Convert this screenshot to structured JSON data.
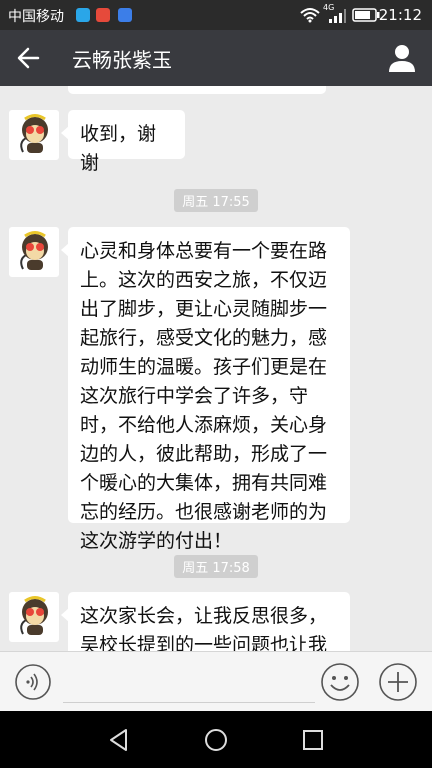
{
  "status_bar": {
    "carrier": "中国移动",
    "network": "4G",
    "time": "21:12"
  },
  "header": {
    "title": "云畅张紫玉"
  },
  "messages": [
    {
      "text": "收到，谢谢"
    },
    {
      "timestamp": "周五 17:55",
      "text": "心灵和身体总要有一个要在路上。这次的西安之旅，不仅迈出了脚步，更让心灵随脚步一起旅行，感受文化的魅力，感动师生的温暖。孩子们更是在这次旅行中学会了许多，守时，不给他人添麻烦，关心身边的人，彼此帮助，形成了一个暖心的大集体，拥有共同难忘的经历。也很感谢老师的为这次游学的付出！"
    },
    {
      "timestamp": "周五 17:58",
      "text": "这次家长会，让我反思很多，吴校长提到的一些问题也让我"
    }
  ],
  "colors": {
    "title_bar": "#393a3f",
    "chat_bg": "#ebebeb",
    "bubble": "#ffffff"
  }
}
